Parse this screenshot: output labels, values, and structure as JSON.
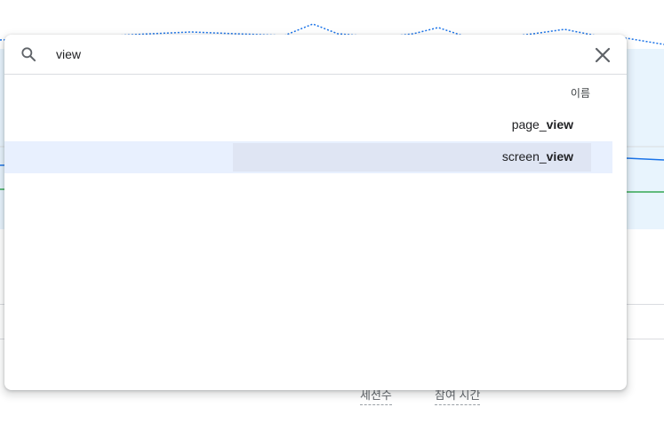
{
  "search": {
    "value": "view",
    "placeholder": ""
  },
  "results": {
    "column_header": "이름",
    "items": [
      {
        "prefix": "page_",
        "match": "view"
      },
      {
        "prefix": "screen_",
        "match": "view"
      }
    ],
    "selected_index": 1
  },
  "background": {
    "metrics": [
      "세션수",
      "참여 시간"
    ]
  },
  "colors": {
    "accent_blue": "#1a73e8",
    "accent_green": "#34a853",
    "selected_row": "#e8f0fe"
  }
}
